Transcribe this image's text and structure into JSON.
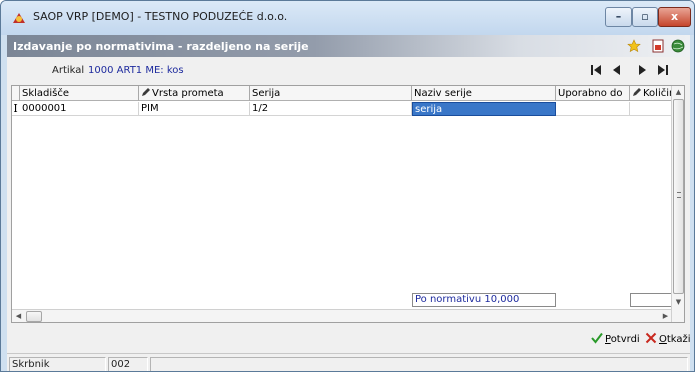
{
  "window": {
    "title": "SAOP VRP [DEMO] - TESTNO PODUZEĆE d.o.o.",
    "minimize": "–",
    "maximize": "▫",
    "close": "x"
  },
  "form": {
    "title": "Izdavanje po normativima - razdeljeno na serije",
    "icons": [
      "star-icon",
      "document-icon",
      "globe-icon"
    ]
  },
  "info": {
    "artikal_label": "Artikal",
    "artikal_value": "1000 ART1 ME: kos",
    "nav": [
      "first-icon",
      "prev-icon",
      "next-icon",
      "last-icon"
    ]
  },
  "grid": {
    "columns": [
      {
        "label": "Skladišče",
        "editable": false
      },
      {
        "label": "Vrsta prometa",
        "editable": true
      },
      {
        "label": "Serija",
        "editable": false
      },
      {
        "label": "Naziv serije",
        "editable": false
      },
      {
        "label": "Uporabno do",
        "editable": false
      },
      {
        "label": "Količina",
        "editable": true
      }
    ],
    "rows": [
      {
        "indicator": "I",
        "skladisce": "0000001",
        "vrsta_prometa": "PIM",
        "serija": "1/2",
        "naziv_serije": "serija",
        "uporabno_do": "",
        "kolicina": ""
      }
    ],
    "footer_normativ": "Po normativu 10,000",
    "footer_kolicina": ""
  },
  "actions": {
    "potvrdi": "Potvrdi",
    "otkazi": "Otkaži"
  },
  "status": {
    "user": "Skrbnik",
    "code": "002"
  },
  "colors": {
    "selection": "#3a77c8",
    "link_blue": "#1e2b9e",
    "confirm_green": "#2a9a2a",
    "cancel_red": "#c8281e"
  }
}
